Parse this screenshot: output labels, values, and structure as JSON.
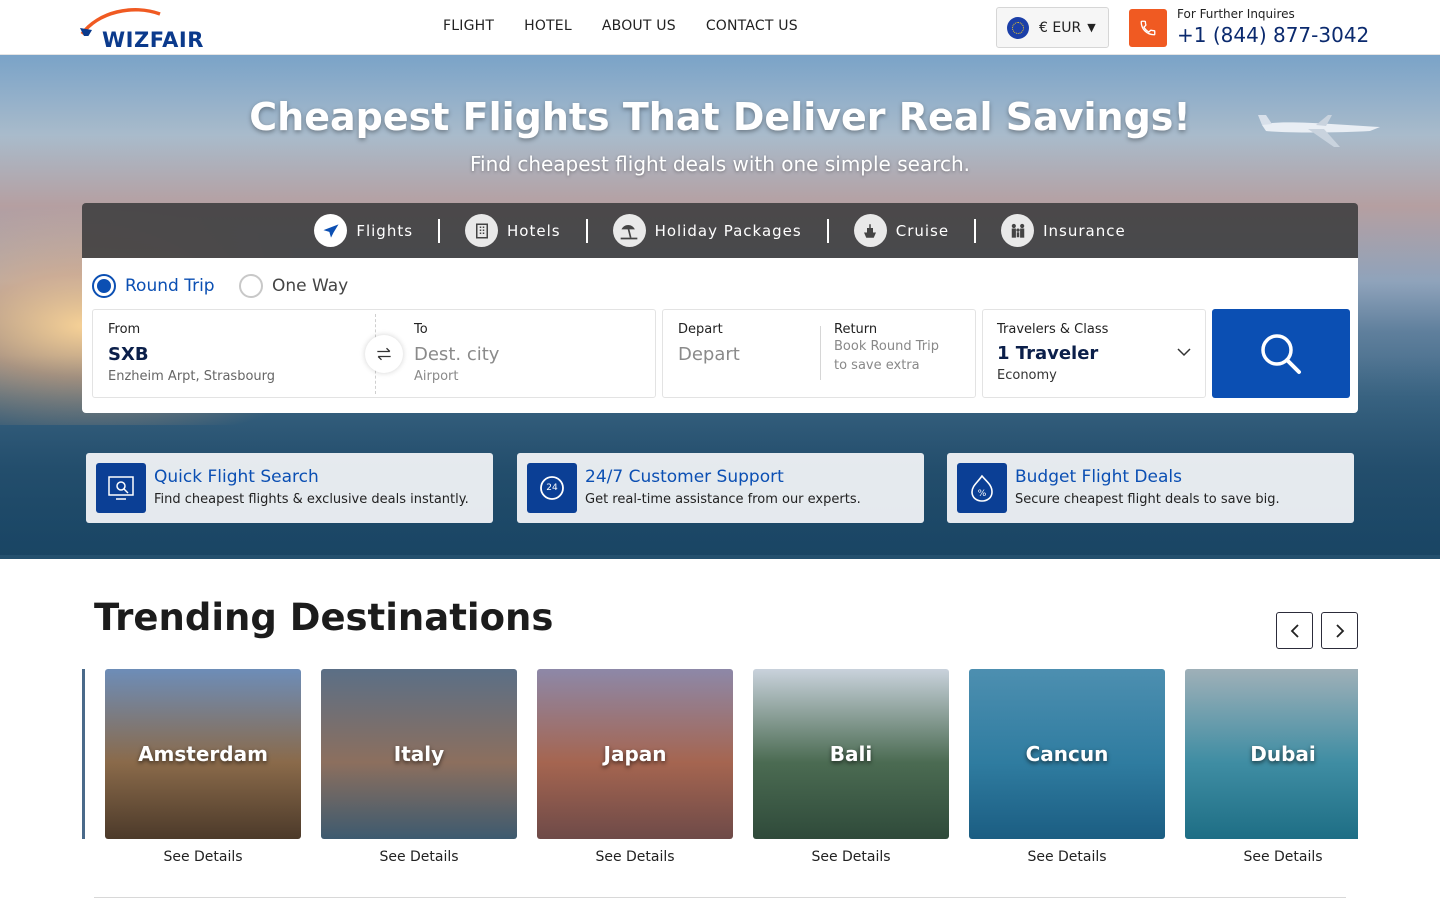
{
  "brand": {
    "logo_text": "WIZFAIR",
    "primary": "#0b4fb3",
    "accent": "#f05a22"
  },
  "nav": [
    "FLIGHT",
    "HOTEL",
    "ABOUT US",
    "CONTACT US"
  ],
  "currency": {
    "flag": "eu-flag-icon",
    "label": "€ EUR"
  },
  "contact": {
    "caption": "For Further Inquires",
    "phone": "+1 (844) 877-3042"
  },
  "hero": {
    "title": "Cheapest Flights That Deliver Real Savings!",
    "subtitle": "Find cheapest flight deals with one simple search."
  },
  "tabs": [
    {
      "label": "Flights",
      "icon": "airplane-icon",
      "active": true
    },
    {
      "label": "Hotels",
      "icon": "building-icon",
      "active": false
    },
    {
      "label": "Holiday Packages",
      "icon": "beach-umbrella-icon",
      "active": false
    },
    {
      "label": "Cruise",
      "icon": "ship-icon",
      "active": false
    },
    {
      "label": "Insurance",
      "icon": "family-icon",
      "active": false
    }
  ],
  "search": {
    "trip_types": [
      {
        "label": "Round Trip",
        "selected": true
      },
      {
        "label": "One Way",
        "selected": false
      }
    ],
    "from": {
      "label": "From",
      "code": "SXB",
      "airport": "Enzheim Arpt, Strasbourg"
    },
    "to": {
      "label": "To",
      "placeholder": "Dest. city",
      "sub": "Airport"
    },
    "depart": {
      "label": "Depart",
      "placeholder": "Depart"
    },
    "return": {
      "label": "Return",
      "hint_line1": "Book Round Trip",
      "hint_line2": "to save extra"
    },
    "travelers": {
      "label": "Travelers & Class",
      "value": "1 Traveler",
      "class": "Economy"
    }
  },
  "features": [
    {
      "title": "Quick Flight Search",
      "desc": "Find cheapest flights & exclusive deals instantly.",
      "icon": "search-screen-icon"
    },
    {
      "title": "24/7 Customer Support",
      "desc": "Get real-time assistance from our experts.",
      "icon": "support-24-icon"
    },
    {
      "title": "Budget Flight Deals",
      "desc": "Secure cheapest flight deals to save big.",
      "icon": "discount-fire-icon"
    }
  ],
  "trending": {
    "title": "Trending Destinations",
    "link_label": "See Details",
    "items": [
      {
        "name": "Amsterdam",
        "colors": [
          "#6d8db8",
          "#8a6a4a",
          "#4c3a2a"
        ]
      },
      {
        "name": "Italy",
        "colors": [
          "#5b6f86",
          "#8c6f5e",
          "#3d5a6f"
        ]
      },
      {
        "name": "Japan",
        "colors": [
          "#8d88a8",
          "#a56550",
          "#6e4a48"
        ]
      },
      {
        "name": "Bali",
        "colors": [
          "#c9d2dc",
          "#4b6b52",
          "#2f4a3a"
        ]
      },
      {
        "name": "Cancun",
        "colors": [
          "#4d8fb0",
          "#2f7ca0",
          "#1b5d82"
        ]
      },
      {
        "name": "Dubai",
        "colors": [
          "#9fb0b8",
          "#3f8da3",
          "#1e6e85"
        ]
      }
    ]
  }
}
